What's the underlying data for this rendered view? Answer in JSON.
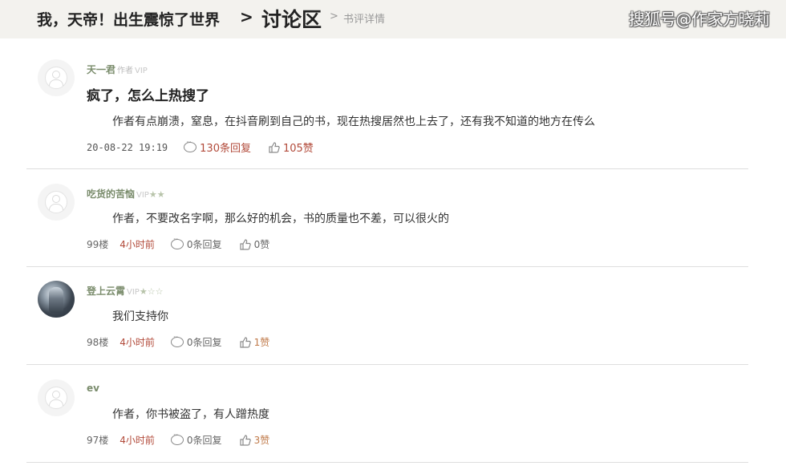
{
  "header": {
    "book_title": "我，天帝！出生震惊了世界",
    "separator": ">",
    "section": "讨论区",
    "sub_separator": ">",
    "sub_section": "书评详情",
    "watermark": "搜狐号@作家方晓莉"
  },
  "post": {
    "user": "天一君",
    "role_tag": "作者",
    "vip": "VIP",
    "title": "疯了，怎么上热搜了",
    "content": "作者有点崩溃，窒息，在抖音刷到自己的书，现在热搜居然也上去了，还有我不知道的地方在传么",
    "date": "20-08-22 19:19",
    "replies": "130条回复",
    "likes": "105赞"
  },
  "comments": [
    {
      "user": "吃货的苦恼",
      "vip": "VIP",
      "stars": "★★",
      "content": "作者，不要改名字啊，那么好的机会，书的质量也不差，可以很火的",
      "floor": "99楼",
      "time": "4小时前",
      "replies": "0条回复",
      "likes": "0赞"
    },
    {
      "user": "登上云霄",
      "vip": "VIP",
      "stars": "★☆☆",
      "content": "我们支持你",
      "floor": "98楼",
      "time": "4小时前",
      "replies": "0条回复",
      "likes": "1赞"
    },
    {
      "user": "ev",
      "content": "作者，你书被盗了，有人蹭热度",
      "floor": "97楼",
      "time": "4小时前",
      "replies": "0条回复",
      "likes": "3赞"
    }
  ],
  "icons": {
    "reply": "comment-bubble-icon",
    "like": "thumbs-up-icon",
    "avatar": "default-avatar-icon"
  },
  "colors": {
    "header_bg": "#f3f2ee",
    "username": "#7a8c6c",
    "highlight": "#b24a3a",
    "divider": "#dedede"
  }
}
